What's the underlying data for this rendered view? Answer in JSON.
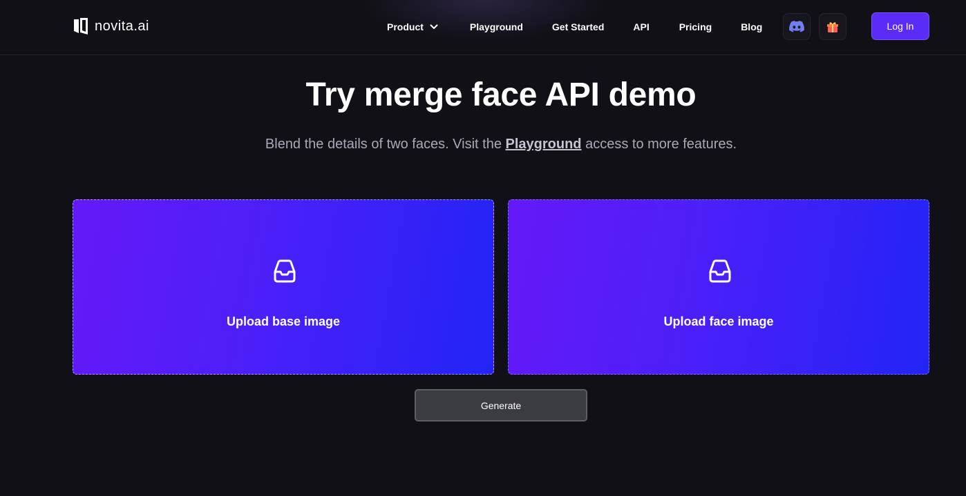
{
  "header": {
    "logo_text": "novita.ai",
    "nav": [
      {
        "label": "Product"
      },
      {
        "label": "Playground"
      },
      {
        "label": "Get Started"
      },
      {
        "label": "API"
      },
      {
        "label": "Pricing"
      },
      {
        "label": "Blog"
      }
    ],
    "icons": [
      "discord-icon",
      "gift-icon"
    ],
    "login_label": "Log In"
  },
  "hero": {
    "title": "Try merge face API demo",
    "subtitle_before": "Blend the details of two faces. Visit the ",
    "subtitle_link": "Playground",
    "subtitle_after": " access to more features."
  },
  "uploads": [
    {
      "label": "Upload base image",
      "icon": "inbox-icon"
    },
    {
      "label": "Upload face image",
      "icon": "inbox-icon"
    }
  ],
  "generate_label": "Generate",
  "colors": {
    "background": "#101016",
    "accent": "#5b2cf6",
    "gradient_start": "#6419f8",
    "gradient_end": "#2224f5",
    "button_gray": "#3b3b42"
  }
}
